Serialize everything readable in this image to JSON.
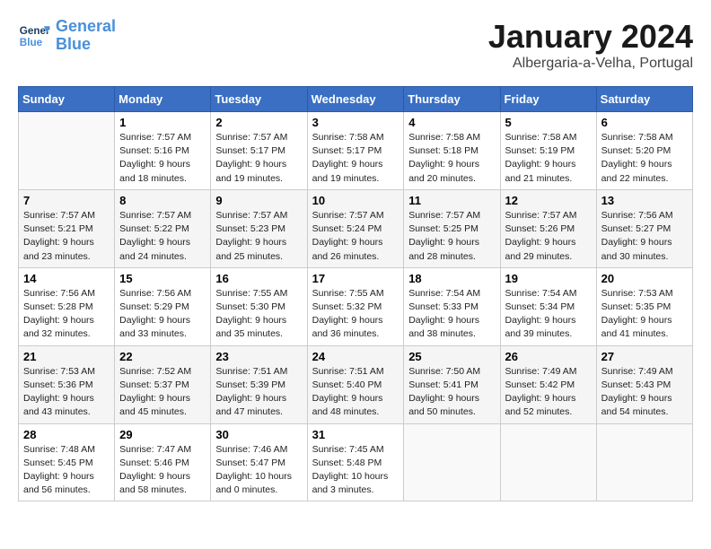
{
  "header": {
    "logo_line1": "General",
    "logo_line2": "Blue",
    "title": "January 2024",
    "subtitle": "Albergaria-a-Velha, Portugal"
  },
  "columns": [
    "Sunday",
    "Monday",
    "Tuesday",
    "Wednesday",
    "Thursday",
    "Friday",
    "Saturday"
  ],
  "weeks": [
    [
      {
        "day": "",
        "info": ""
      },
      {
        "day": "1",
        "info": "Sunrise: 7:57 AM\nSunset: 5:16 PM\nDaylight: 9 hours\nand 18 minutes."
      },
      {
        "day": "2",
        "info": "Sunrise: 7:57 AM\nSunset: 5:17 PM\nDaylight: 9 hours\nand 19 minutes."
      },
      {
        "day": "3",
        "info": "Sunrise: 7:58 AM\nSunset: 5:17 PM\nDaylight: 9 hours\nand 19 minutes."
      },
      {
        "day": "4",
        "info": "Sunrise: 7:58 AM\nSunset: 5:18 PM\nDaylight: 9 hours\nand 20 minutes."
      },
      {
        "day": "5",
        "info": "Sunrise: 7:58 AM\nSunset: 5:19 PM\nDaylight: 9 hours\nand 21 minutes."
      },
      {
        "day": "6",
        "info": "Sunrise: 7:58 AM\nSunset: 5:20 PM\nDaylight: 9 hours\nand 22 minutes."
      }
    ],
    [
      {
        "day": "7",
        "info": "Sunrise: 7:57 AM\nSunset: 5:21 PM\nDaylight: 9 hours\nand 23 minutes."
      },
      {
        "day": "8",
        "info": "Sunrise: 7:57 AM\nSunset: 5:22 PM\nDaylight: 9 hours\nand 24 minutes."
      },
      {
        "day": "9",
        "info": "Sunrise: 7:57 AM\nSunset: 5:23 PM\nDaylight: 9 hours\nand 25 minutes."
      },
      {
        "day": "10",
        "info": "Sunrise: 7:57 AM\nSunset: 5:24 PM\nDaylight: 9 hours\nand 26 minutes."
      },
      {
        "day": "11",
        "info": "Sunrise: 7:57 AM\nSunset: 5:25 PM\nDaylight: 9 hours\nand 28 minutes."
      },
      {
        "day": "12",
        "info": "Sunrise: 7:57 AM\nSunset: 5:26 PM\nDaylight: 9 hours\nand 29 minutes."
      },
      {
        "day": "13",
        "info": "Sunrise: 7:56 AM\nSunset: 5:27 PM\nDaylight: 9 hours\nand 30 minutes."
      }
    ],
    [
      {
        "day": "14",
        "info": "Sunrise: 7:56 AM\nSunset: 5:28 PM\nDaylight: 9 hours\nand 32 minutes."
      },
      {
        "day": "15",
        "info": "Sunrise: 7:56 AM\nSunset: 5:29 PM\nDaylight: 9 hours\nand 33 minutes."
      },
      {
        "day": "16",
        "info": "Sunrise: 7:55 AM\nSunset: 5:30 PM\nDaylight: 9 hours\nand 35 minutes."
      },
      {
        "day": "17",
        "info": "Sunrise: 7:55 AM\nSunset: 5:32 PM\nDaylight: 9 hours\nand 36 minutes."
      },
      {
        "day": "18",
        "info": "Sunrise: 7:54 AM\nSunset: 5:33 PM\nDaylight: 9 hours\nand 38 minutes."
      },
      {
        "day": "19",
        "info": "Sunrise: 7:54 AM\nSunset: 5:34 PM\nDaylight: 9 hours\nand 39 minutes."
      },
      {
        "day": "20",
        "info": "Sunrise: 7:53 AM\nSunset: 5:35 PM\nDaylight: 9 hours\nand 41 minutes."
      }
    ],
    [
      {
        "day": "21",
        "info": "Sunrise: 7:53 AM\nSunset: 5:36 PM\nDaylight: 9 hours\nand 43 minutes."
      },
      {
        "day": "22",
        "info": "Sunrise: 7:52 AM\nSunset: 5:37 PM\nDaylight: 9 hours\nand 45 minutes."
      },
      {
        "day": "23",
        "info": "Sunrise: 7:51 AM\nSunset: 5:39 PM\nDaylight: 9 hours\nand 47 minutes."
      },
      {
        "day": "24",
        "info": "Sunrise: 7:51 AM\nSunset: 5:40 PM\nDaylight: 9 hours\nand 48 minutes."
      },
      {
        "day": "25",
        "info": "Sunrise: 7:50 AM\nSunset: 5:41 PM\nDaylight: 9 hours\nand 50 minutes."
      },
      {
        "day": "26",
        "info": "Sunrise: 7:49 AM\nSunset: 5:42 PM\nDaylight: 9 hours\nand 52 minutes."
      },
      {
        "day": "27",
        "info": "Sunrise: 7:49 AM\nSunset: 5:43 PM\nDaylight: 9 hours\nand 54 minutes."
      }
    ],
    [
      {
        "day": "28",
        "info": "Sunrise: 7:48 AM\nSunset: 5:45 PM\nDaylight: 9 hours\nand 56 minutes."
      },
      {
        "day": "29",
        "info": "Sunrise: 7:47 AM\nSunset: 5:46 PM\nDaylight: 9 hours\nand 58 minutes."
      },
      {
        "day": "30",
        "info": "Sunrise: 7:46 AM\nSunset: 5:47 PM\nDaylight: 10 hours\nand 0 minutes."
      },
      {
        "day": "31",
        "info": "Sunrise: 7:45 AM\nSunset: 5:48 PM\nDaylight: 10 hours\nand 3 minutes."
      },
      {
        "day": "",
        "info": ""
      },
      {
        "day": "",
        "info": ""
      },
      {
        "day": "",
        "info": ""
      }
    ]
  ]
}
